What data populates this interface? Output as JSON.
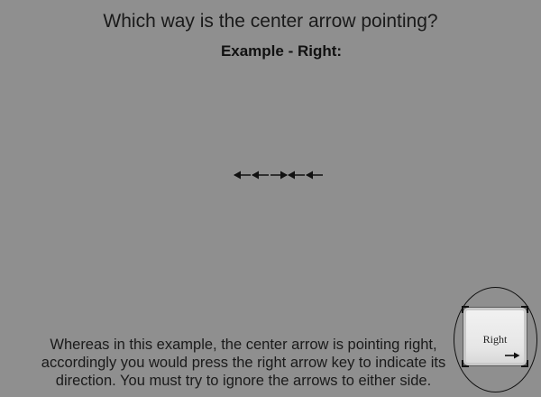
{
  "question": "Which way is the center arrow pointing?",
  "example_label": "Example - Right:",
  "stimulus": {
    "arrows": [
      {
        "direction": "left",
        "role": "flanker"
      },
      {
        "direction": "left",
        "role": "flanker"
      },
      {
        "direction": "right",
        "role": "target"
      },
      {
        "direction": "left",
        "role": "flanker"
      },
      {
        "direction": "left",
        "role": "flanker"
      }
    ]
  },
  "instructions": "Whereas in this example, the center arrow is pointing right, accordingly you would press the right arrow key to indicate its direction. You must try to ignore the arrows to either side.",
  "key_hint": {
    "label": "Right",
    "arrow": "right-arrow-icon"
  },
  "colors": {
    "background": "#8f8f8f",
    "text": "#1a1a1a",
    "key_face": "#ececec"
  }
}
